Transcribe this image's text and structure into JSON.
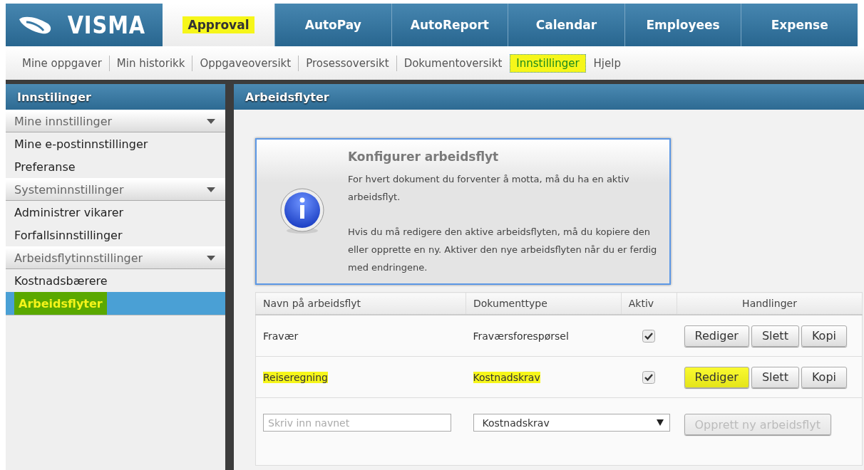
{
  "logo": {
    "text": "VISMA"
  },
  "tabs": [
    {
      "label": "Approval",
      "selected": true,
      "highlighted": true
    },
    {
      "label": "AutoPay",
      "selected": false,
      "highlighted": false
    },
    {
      "label": "AutoReport",
      "selected": false,
      "highlighted": false
    },
    {
      "label": "Calendar",
      "selected": false,
      "highlighted": false
    },
    {
      "label": "Employees",
      "selected": false,
      "highlighted": false
    },
    {
      "label": "Expense",
      "selected": false,
      "highlighted": false
    }
  ],
  "subnav": [
    {
      "label": "Mine oppgaver",
      "selected": false,
      "highlighted": false
    },
    {
      "label": "Min historikk",
      "selected": false,
      "highlighted": false
    },
    {
      "label": "Oppgaveoversikt",
      "selected": false,
      "highlighted": false
    },
    {
      "label": "Prosessoversikt",
      "selected": false,
      "highlighted": false
    },
    {
      "label": "Dokumentoversikt",
      "selected": false,
      "highlighted": false
    },
    {
      "label": "Innstillinger",
      "selected": true,
      "highlighted": true
    },
    {
      "label": "Hjelp",
      "selected": false,
      "highlighted": false
    }
  ],
  "sidebar": {
    "title": "Innstilinger",
    "sections": [
      {
        "label": "Mine innstillinger",
        "expanded": true,
        "items": [
          {
            "label": "Mine e-postinnstillinger",
            "selected": false,
            "highlighted": false
          },
          {
            "label": "Preferanse",
            "selected": false,
            "highlighted": false
          }
        ]
      },
      {
        "label": "Systeminnstillinger",
        "expanded": true,
        "items": [
          {
            "label": "Administrer vikarer",
            "selected": false,
            "highlighted": false
          },
          {
            "label": "Forfallsinnstillinger",
            "selected": false,
            "highlighted": false
          }
        ]
      },
      {
        "label": "Arbeidsflytinnstillinger",
        "expanded": true,
        "items": [
          {
            "label": "Kostnadsbærere",
            "selected": false,
            "highlighted": false
          },
          {
            "label": "Arbeidsflyter",
            "selected": true,
            "highlighted": true
          }
        ]
      }
    ]
  },
  "main": {
    "title": "Arbeidsflyter",
    "info": {
      "title": "Konfigurer arbeidsflyt",
      "paragraphs": [
        "For hvert dokument du forventer å motta, må du ha en aktiv arbeidsflyt.",
        "Hvis du må redigere den aktive arbeidsflyten, må du kopiere den eller opprette en ny. Aktiver den nye arbeidsflyten når du er ferdig med endringene."
      ]
    },
    "table": {
      "columns": [
        "Navn på arbeidsflyt",
        "Dokumenttype",
        "Aktiv",
        "Handlinger"
      ],
      "rows": [
        {
          "name": {
            "text": "Fravær",
            "highlighted": false
          },
          "document_type": {
            "text": "Fraværsforespørsel",
            "highlighted": false
          },
          "active": true,
          "actions": [
            {
              "label": "Rediger",
              "highlighted": false
            },
            {
              "label": "Slett",
              "highlighted": false
            },
            {
              "label": "Kopi",
              "highlighted": false
            }
          ]
        },
        {
          "name": {
            "text": "Reiseregning",
            "highlighted": true
          },
          "document_type": {
            "text": "Kostnadskrav",
            "highlighted": true
          },
          "active": true,
          "actions": [
            {
              "label": "Rediger",
              "highlighted": true
            },
            {
              "label": "Slett",
              "highlighted": false
            },
            {
              "label": "Kopi",
              "highlighted": false
            }
          ]
        }
      ]
    },
    "new_row": {
      "name_field": {
        "placeholder": "Skriv inn navnet"
      },
      "type_select": {
        "value": "Kostnadskrav"
      },
      "create_button": {
        "label": "Opprett ny arbeidsflyt",
        "disabled": true
      }
    }
  }
}
